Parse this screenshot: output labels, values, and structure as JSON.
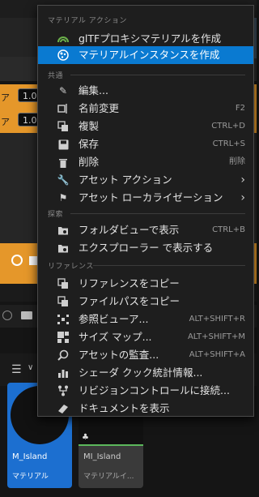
{
  "background": {
    "fields": [
      {
        "prefix": "ア",
        "value": "1.0"
      },
      {
        "prefix": "ア",
        "value": "1.0"
      }
    ],
    "thumbnails": [
      {
        "name": "M_Island",
        "type": "マテリアル"
      },
      {
        "name": "MI_Island",
        "type": "マテリアルイ..."
      }
    ]
  },
  "menu": {
    "sections": {
      "material_action": "マテリアル アクション",
      "common": "共通",
      "explore": "探索",
      "references": "リファレンス"
    },
    "items": {
      "gltf_proxy": {
        "label": "glTFプロキシマテリアルを作成",
        "shortcut": ""
      },
      "create_instance": {
        "label": "マテリアルインスタンスを作成",
        "shortcut": ""
      },
      "edit": {
        "label": "編集...",
        "shortcut": ""
      },
      "rename": {
        "label": "名前変更",
        "shortcut": "F2"
      },
      "duplicate": {
        "label": "複製",
        "shortcut": "CTRL+D"
      },
      "save": {
        "label": "保存",
        "shortcut": "CTRL+S"
      },
      "delete": {
        "label": "削除",
        "shortcut": "削除"
      },
      "asset_actions": {
        "label": "アセット アクション",
        "shortcut": ""
      },
      "asset_localization": {
        "label": "アセット ローカライゼーション",
        "shortcut": ""
      },
      "show_in_folder": {
        "label": "フォルダビューで表示",
        "shortcut": "CTRL+B"
      },
      "show_in_explorer": {
        "label": "エクスプローラー で表示する",
        "shortcut": ""
      },
      "copy_reference": {
        "label": "リファレンスをコピー",
        "shortcut": ""
      },
      "copy_file_path": {
        "label": "ファイルパスをコピー",
        "shortcut": ""
      },
      "reference_viewer": {
        "label": "参照ビューア...",
        "shortcut": "ALT+SHIFT+R"
      },
      "size_map": {
        "label": "サイズ マップ...",
        "shortcut": "ALT+SHIFT+M"
      },
      "audit_assets": {
        "label": "アセットの監査...",
        "shortcut": "ALT+SHIFT+A"
      },
      "shader_cook_stats": {
        "label": "シェーダ クック統計情報...",
        "shortcut": ""
      },
      "source_control": {
        "label": "リビジョンコントロールに接続...",
        "shortcut": ""
      },
      "show_docs": {
        "label": "ドキュメントを表示",
        "shortcut": ""
      }
    }
  },
  "colors": {
    "highlight": "#0a7ad1",
    "menu_bg": "#1e1e1e",
    "orange_panel": "#e5972a",
    "selected_thumb": "#1c6fd0"
  }
}
